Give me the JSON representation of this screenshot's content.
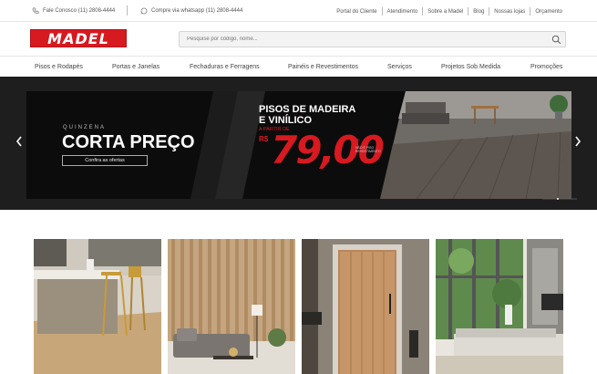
{
  "topbar": {
    "contact": "Fale Conosco (11) 2808-4444",
    "whatsapp": "Compre via whatsapp (11) 2808-4444",
    "links": [
      "Portal do Cliente",
      "Atendimento",
      "Sobre a Madel",
      "Blog",
      "Nossas lojas",
      "Orçamento"
    ]
  },
  "header": {
    "logo_text": "MADEL",
    "search_placeholder": "Pesquise por código, nome..."
  },
  "nav": {
    "items": [
      "Pisos e Rodapés",
      "Portas e Janelas",
      "Fechaduras e Ferragens",
      "Painéis e Revestimentos",
      "Serviços",
      "Projetos Sob Medida",
      "Promoções"
    ]
  },
  "banner": {
    "kicker": "QUINZENA",
    "headline": "CORTA PREÇO",
    "cta": "Confira as ofertas",
    "product_line1": "PISOS DE MADEIRA",
    "product_line2": "E VINÍLICO",
    "from_label": "A PARTIR DE",
    "currency": "R$",
    "price": "79,00",
    "unit": "M²",
    "note": "NÃO É PISO REVESTIMENTO"
  },
  "colors": {
    "brand": "#d71920",
    "banner_bg": "#0c0c0c"
  }
}
